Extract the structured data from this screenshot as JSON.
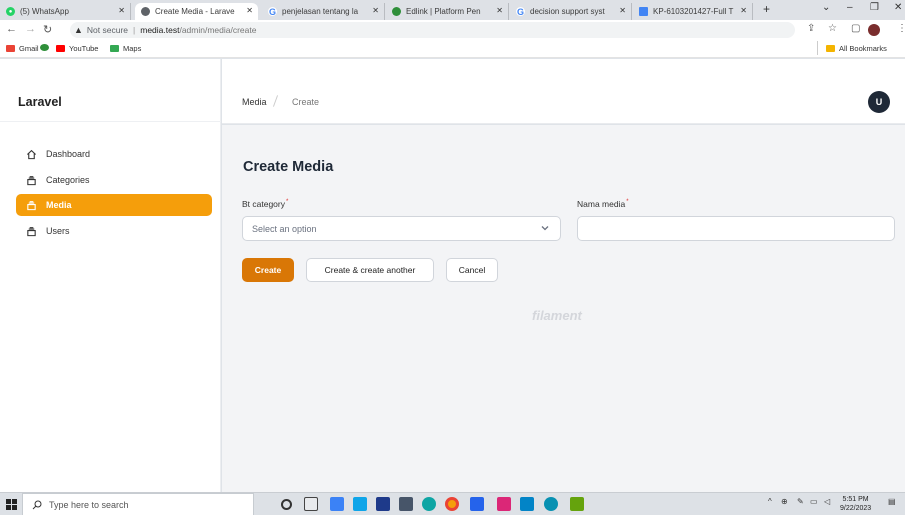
{
  "browser": {
    "tabs": [
      {
        "title": "(5) WhatsApp",
        "icon": "whatsapp-icon"
      },
      {
        "title": "Create Media - Larave",
        "icon": "globe-icon"
      },
      {
        "title": "penjelasan tentang la",
        "icon": "google-icon"
      },
      {
        "title": "Edlink | Platform Pen",
        "icon": "edlink-icon"
      },
      {
        "title": "decision support syst",
        "icon": "google-icon"
      },
      {
        "title": "KP-6103201427-Full T",
        "icon": "docs-icon"
      }
    ],
    "new_tab": "+",
    "address": {
      "security": "Not secure",
      "host": "media.test",
      "path": "/admin/media/create"
    },
    "bookmarks": [
      {
        "label": "Gmail"
      },
      {
        "label": ""
      },
      {
        "label": "YouTube"
      },
      {
        "label": "Maps"
      }
    ],
    "all_bookmarks": "All Bookmarks"
  },
  "sidebar": {
    "brand": "Laravel",
    "items": [
      {
        "label": "Dashboard",
        "icon": "home-icon",
        "active": false
      },
      {
        "label": "Categories",
        "icon": "collection-icon",
        "active": false
      },
      {
        "label": "Media",
        "icon": "collection-icon",
        "active": true
      },
      {
        "label": "Users",
        "icon": "collection-icon",
        "active": false
      }
    ]
  },
  "topbar": {
    "breadcrumb": [
      "Media",
      "Create"
    ],
    "avatar_initial": "U"
  },
  "page": {
    "title": "Create Media",
    "fields": {
      "category": {
        "label": "Bt category",
        "required": "*",
        "placeholder": "Select an option"
      },
      "name": {
        "label": "Nama media",
        "required": "*",
        "value": ""
      }
    },
    "buttons": {
      "create": "Create",
      "create_another": "Create & create another",
      "cancel": "Cancel"
    },
    "footer_brand": "filament"
  },
  "taskbar": {
    "search_placeholder": "Type here to search",
    "time": "5:51 PM",
    "date": "9/22/2023"
  },
  "colors": {
    "accent": "#f59e0b",
    "primary_button": "#d97706",
    "background": "#f3f4f6"
  }
}
